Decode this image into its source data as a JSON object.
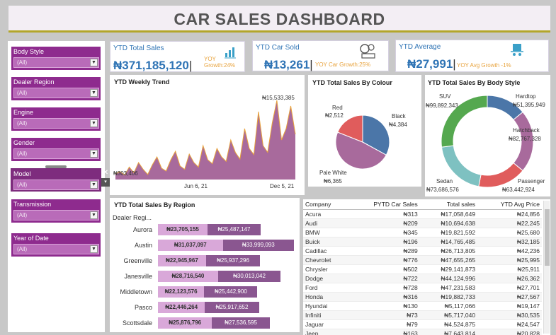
{
  "title": "CAR SALES DASHBOARD",
  "slicers": [
    {
      "label": "Body Style",
      "value": "(All)"
    },
    {
      "label": "Dealer Region",
      "value": "(All)"
    },
    {
      "label": "Engine",
      "value": "(All)"
    },
    {
      "label": "Gender",
      "value": "(All)"
    },
    {
      "label": "Model",
      "value": "(All)"
    },
    {
      "label": "Transmission",
      "value": "(All)"
    },
    {
      "label": "Year of Date",
      "value": "(All)"
    }
  ],
  "kpis": [
    {
      "title": "YTD Total Sales",
      "value": "₦371,185,120",
      "growth": "YOY Growth:24%",
      "icon": "bar-chart-icon"
    },
    {
      "title": "YTD Car Sold",
      "value": "₦13,261",
      "growth": "YOY Car Growth:25%",
      "icon": "money-icon"
    },
    {
      "title": "YTD  Average",
      "value": "₦27,991",
      "growth": "YOY  Avg  Growth -1%",
      "icon": "cart-icon"
    }
  ],
  "weekly": {
    "title": "YTD Weekly Trend",
    "max_label": "₦15,533,385",
    "min_label": "₦303,406",
    "x_ticks": [
      "Jun 6, 21",
      "Dec 5, 21"
    ],
    "color": "#a86a9c"
  },
  "colour": {
    "title": "YTD Total Sales By Colour",
    "slices": [
      {
        "name": "Black",
        "value": "₦4,384",
        "share": 0.33,
        "color": "#4b76a8"
      },
      {
        "name": "Pale White",
        "value": "₦6,365",
        "share": 0.48,
        "color": "#a86a9c"
      },
      {
        "name": "Red",
        "value": "₦2,512",
        "share": 0.19,
        "color": "#e05c5c"
      }
    ]
  },
  "body_style": {
    "title": "YTD Total Sales  By Body Style",
    "slices": [
      {
        "name": "Hardtop",
        "value": "₦51,395,949",
        "share": 0.14,
        "color": "#4b76a8"
      },
      {
        "name": "Hatchback",
        "value": "₦82,767,328",
        "share": 0.22,
        "color": "#a86a9c"
      },
      {
        "name": "Passenger",
        "value": "₦63,442,924",
        "share": 0.17,
        "color": "#e05c5c"
      },
      {
        "name": "Sedan",
        "value": "₦73,686,576",
        "share": 0.2,
        "color": "#7ec1c1"
      },
      {
        "name": "SUV",
        "value": "₦99,892,343",
        "share": 0.27,
        "color": "#55a84f"
      }
    ]
  },
  "region": {
    "title": "YTD Total Sales By Region",
    "header": "Dealer Regi...",
    "rows": [
      {
        "name": "Aurora",
        "a": "₦23,705,155",
        "b": "₦25,487,147",
        "av": 23705155,
        "bv": 25487147
      },
      {
        "name": "Austin",
        "a": "₦31,037,097",
        "b": "₦33,999,093",
        "av": 31037097,
        "bv": 33999093
      },
      {
        "name": "Greenville",
        "a": "₦22,945,967",
        "b": "₦25,937,296",
        "av": 22945967,
        "bv": 25937296
      },
      {
        "name": "Janesville",
        "a": "₦28,716,540",
        "b": "₦30,013,042",
        "av": 28716540,
        "bv": 30013042
      },
      {
        "name": "Middletown",
        "a": "₦22,123,576",
        "b": "₦25,442,900",
        "av": 22123576,
        "bv": 25442900
      },
      {
        "name": "Pasco",
        "a": "₦22,446,264",
        "b": "₦25,917,652",
        "av": 22446264,
        "bv": 25917652
      },
      {
        "name": "Scottsdale",
        "a": "₦25,876,796",
        "b": "₦27,536,595",
        "av": 25876796,
        "bv": 27536595
      }
    ]
  },
  "table": {
    "columns": [
      "Company",
      "PYTD Car Sales",
      "Total sales",
      "YTD Avg Price"
    ],
    "rows": [
      [
        "Acura",
        "₦313",
        "₦17,058,649",
        "₦24,856"
      ],
      [
        "Audi",
        "₦209",
        "₦10,694,638",
        "₦22,245"
      ],
      [
        "BMW",
        "₦345",
        "₦19,821,592",
        "₦25,680"
      ],
      [
        "Buick",
        "₦196",
        "₦14,765,485",
        "₦32,185"
      ],
      [
        "Cadillac",
        "₦289",
        "₦26,713,805",
        "₦42,236"
      ],
      [
        "Chevrolet",
        "₦776",
        "₦47,655,265",
        "₦25,995"
      ],
      [
        "Chrysler",
        "₦502",
        "₦29,141,873",
        "₦25,911"
      ],
      [
        "Dodge",
        "₦722",
        "₦44,124,996",
        "₦26,362"
      ],
      [
        "Ford",
        "₦728",
        "₦47,231,583",
        "₦27,701"
      ],
      [
        "Honda",
        "₦316",
        "₦19,882,733",
        "₦27,567"
      ],
      [
        "Hyundai",
        "₦130",
        "₦5,117,066",
        "₦19,147"
      ],
      [
        "Infiniti",
        "₦73",
        "₦5,717,040",
        "₦30,535"
      ],
      [
        "Jaguar",
        "₦79",
        "₦4,524,875",
        "₦24,547"
      ],
      [
        "Jeep",
        "₦163",
        "₦7,643,814",
        "₦20,828"
      ]
    ]
  }
}
